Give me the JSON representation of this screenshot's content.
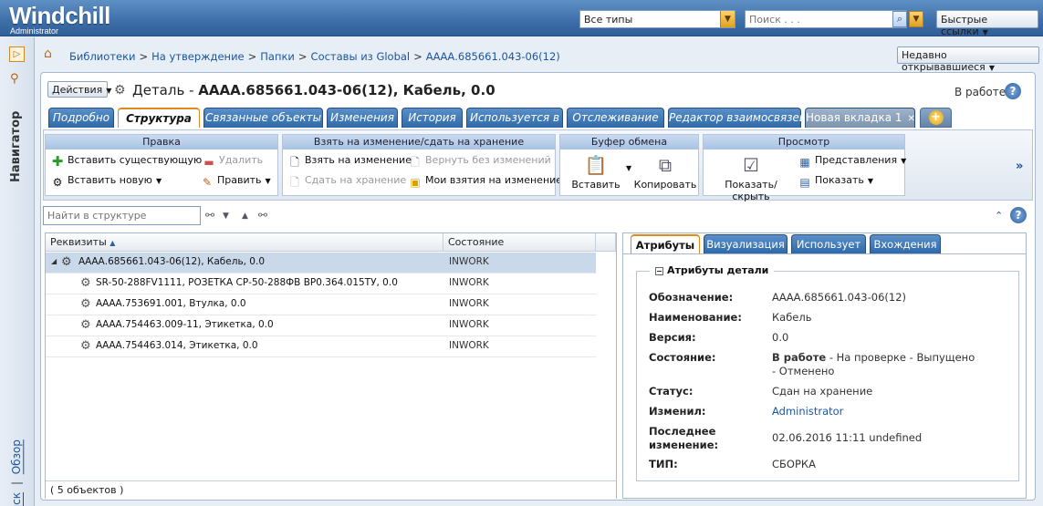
{
  "banner": {
    "logo": "Windchill",
    "user": "Administrator",
    "type_select": "Все типы",
    "search_placeholder": "Поиск . . .",
    "quick_links": "Быстрые ссылки"
  },
  "navigator": {
    "label": "Навигатор",
    "link_search": "Поиск",
    "separator": "|",
    "link_overview": "Обзор"
  },
  "breadcrumb": [
    "Библиотеки",
    "На утверждение",
    "Папки",
    "Составы из Global",
    "АААА.685661.043-06(12)"
  ],
  "recent": "Недавно открывавшиеся",
  "header": {
    "actions": "Действия",
    "title_prefix": "Деталь - ",
    "title_main": "АААА.685661.043-06(12), Кабель, 0.0",
    "status": "В работе",
    "help": "?"
  },
  "tabs": [
    {
      "label": "Подробно"
    },
    {
      "label": "Структура"
    },
    {
      "label": "Связанные объекты"
    },
    {
      "label": "Изменения"
    },
    {
      "label": "История"
    },
    {
      "label": "Используется в"
    },
    {
      "label": "Отслеживание"
    },
    {
      "label": "Редактор взаимосвязей"
    },
    {
      "label": "Новая вкладка 1"
    }
  ],
  "toolbar": {
    "edit": {
      "title": "Правка",
      "insert_existing": "Вставить существующую",
      "insert_new": "Вставить новую",
      "delete": "Удалить",
      "modify": "Править"
    },
    "checkout": {
      "title": "Взять на изменение/сдать на хранение",
      "check_out": "Взять на изменение",
      "undo_checkout": "Вернуть без изменений",
      "check_in": "Сдать на хранение",
      "my_checkouts": "Мои взятия на изменение"
    },
    "clipboard": {
      "title": "Буфер обмена",
      "paste": "Вставить",
      "copy": "Копировать"
    },
    "view": {
      "title": "Просмотр",
      "show_hide": "Показать/скрыть",
      "views": "Представления",
      "show": "Показать"
    }
  },
  "structure": {
    "search_placeholder": "Найти в структуре",
    "col_attributes": "Реквизиты",
    "col_state": "Состояние",
    "rows": [
      {
        "name": "АААА.685661.043-06(12), Кабель, 0.0",
        "state": "INWORK"
      },
      {
        "name": "SR-50-288FV1111, РОЗЕТКА СР-50-288ФВ ВР0.364.015ТУ, 0.0",
        "state": "INWORK"
      },
      {
        "name": "АААА.753691.001, Втулка, 0.0",
        "state": "INWORK"
      },
      {
        "name": "АААА.754463.009-11, Этикетка, 0.0",
        "state": "INWORK"
      },
      {
        "name": "АААА.754463.014, Этикетка, 0.0",
        "state": "INWORK"
      }
    ],
    "footer": "( 5 объектов )"
  },
  "attr_tabs": [
    "Атрибуты",
    "Визуализация",
    "Использует",
    "Вхождения"
  ],
  "attributes": {
    "section_title": "Атрибуты детали",
    "designation_label": "Обозначение:",
    "designation": "АААА.685661.043-06(12)",
    "name_label": "Наименование:",
    "name": "Кабель",
    "version_label": "Версия:",
    "version": "0.0",
    "state_label": "Состояние:",
    "state_current": "В работе",
    "state_rest": " - На проверке - Выпущено - Отменено",
    "status_label": "Статус:",
    "status": "Сдан на хранение",
    "modified_by_label": "Изменил:",
    "modified_by": "Administrator",
    "last_modified_label": "Последнее изменение:",
    "last_modified": "02.06.2016 11:11 undefined",
    "type_label": "ТИП:",
    "type": "СБОРКА"
  }
}
